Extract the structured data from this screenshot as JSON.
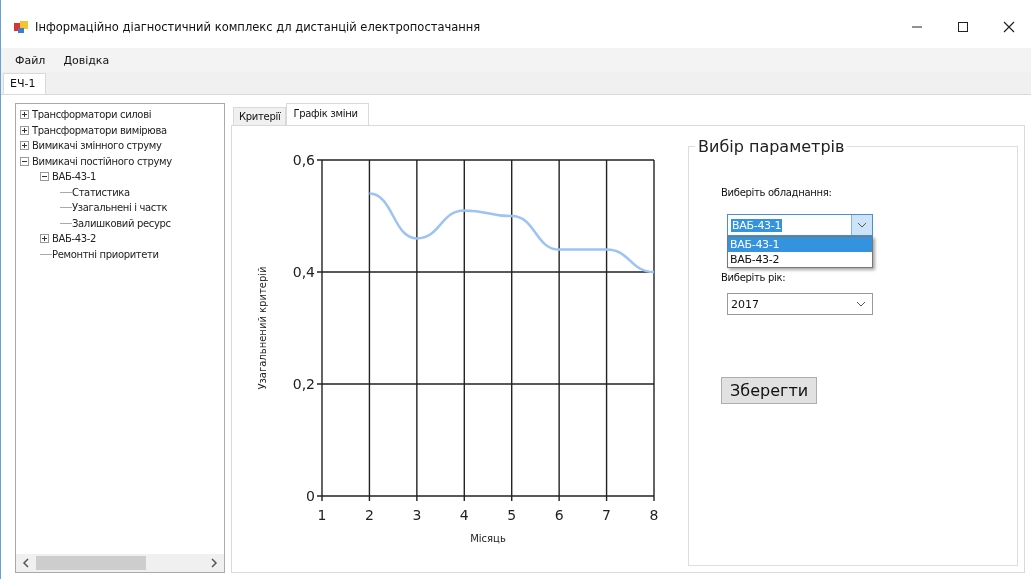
{
  "window": {
    "title": "Інформаційно діагностичний комплекс дл дистанцій електропостачання"
  },
  "menu": [
    "Файл",
    "Довідка"
  ],
  "outer_tabs": [
    {
      "label": "ЕЧ-1",
      "selected": true
    }
  ],
  "tree": [
    {
      "label": "Трансформатори силові",
      "expanded": false
    },
    {
      "label": "Трансформатори вимірюва",
      "expanded": false
    },
    {
      "label": "Вимикачі змінного струму",
      "expanded": false
    },
    {
      "label": "Вимикачі постійного струму",
      "expanded": true,
      "children": [
        {
          "label": "ВАБ-43-1",
          "expanded": true,
          "children": [
            {
              "label": "Статистика"
            },
            {
              "label": "Узагальнені і частк"
            },
            {
              "label": "Залишковий ресурс"
            }
          ]
        },
        {
          "label": "ВАБ-43-2",
          "expanded": false
        },
        {
          "label": "Ремонтні приоритети"
        }
      ]
    }
  ],
  "inner_tabs": [
    {
      "label": "Критерії",
      "selected": false
    },
    {
      "label": "Графік зміни",
      "selected": true
    }
  ],
  "chart_data": {
    "type": "line",
    "xlabel": "Місяць",
    "ylabel": "Узагальнений критерій",
    "x": [
      2,
      3,
      4,
      5,
      6,
      7,
      8
    ],
    "grid": true,
    "series": [
      {
        "color": "#9cc3f5",
        "values": [
          0.54,
          0.46,
          0.51,
          0.5,
          0.44,
          0.44,
          0.4
        ]
      }
    ],
    "xlim": [
      1,
      8
    ],
    "ylim": [
      0,
      0.6
    ],
    "xticks": [
      1,
      2,
      3,
      4,
      5,
      6,
      7,
      8
    ],
    "yticks": [
      {
        "value": 0,
        "label": "0"
      },
      {
        "value": 0.2,
        "label": "0,2"
      },
      {
        "value": 0.4,
        "label": "0,4"
      },
      {
        "value": 0.6,
        "label": "0,6"
      }
    ]
  },
  "parameters": {
    "title": "Вибір параметрів",
    "equipment_label": "Виберіть обладнання:",
    "equipment_combo": {
      "value": "ВАБ-43-1",
      "open": true,
      "options": [
        {
          "label": "ВАБ-43-1",
          "selected": true
        },
        {
          "label": "ВАБ-43-2",
          "selected": false
        }
      ]
    },
    "year_label": "Виберіть рік:",
    "year_combo": {
      "value": "2017"
    },
    "save_button": "Зберегти"
  }
}
